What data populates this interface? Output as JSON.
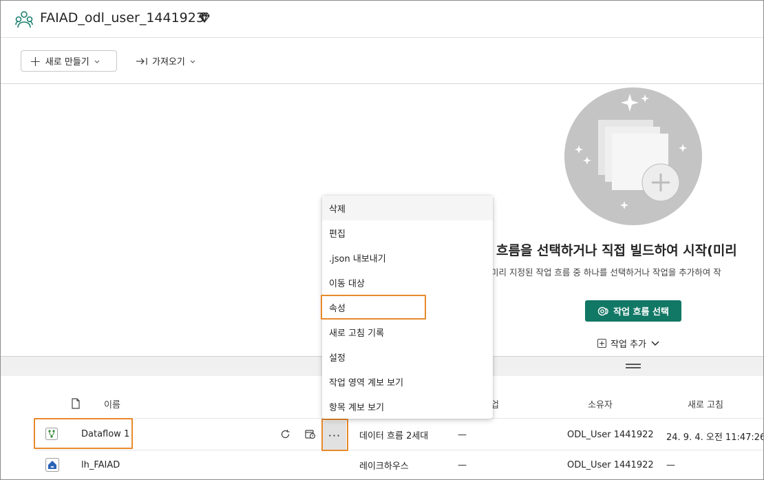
{
  "header": {
    "workspace_title": "FAIAD_odl_user_1441923"
  },
  "toolbar": {
    "new_label": "새로 만들기",
    "import_label": "가져오기"
  },
  "hero": {
    "title": "흐름을 선택하거나 직접 빌드하여 시작(미리",
    "subtitle": "미리 지정된 작업 흐름 중 하나를 선택하거나 작업을 추가하여 작",
    "select_flow_label": "작업 흐름 선택",
    "add_task_label": "작업 추가"
  },
  "table": {
    "headers": {
      "name": "이름",
      "task_partial": "업",
      "owner": "소유자",
      "refresh": "새로 고침"
    },
    "rows": [
      {
        "name": "Dataflow 1",
        "type": "데이터 흐름 2세대",
        "task": "—",
        "owner": "ODL_User 1441922",
        "refreshed": "24. 9. 4. 오전 11:47:26"
      },
      {
        "name": "lh_FAIAD",
        "type": "레이크하우스",
        "task": "—",
        "owner": "ODL_User 1441922",
        "refreshed": "—"
      }
    ]
  },
  "more_label": "···",
  "context_menu": {
    "items": [
      "삭제",
      "편집",
      ".json 내보내기",
      "이동 대상",
      "속성",
      "새로 고침 기록",
      "설정",
      "작업 영역 계보 보기",
      "항목 계보 보기"
    ],
    "hovered_index": 0,
    "highlighted_index": 4
  },
  "colors": {
    "accent": "#117865",
    "highlight": "#e8892a"
  }
}
